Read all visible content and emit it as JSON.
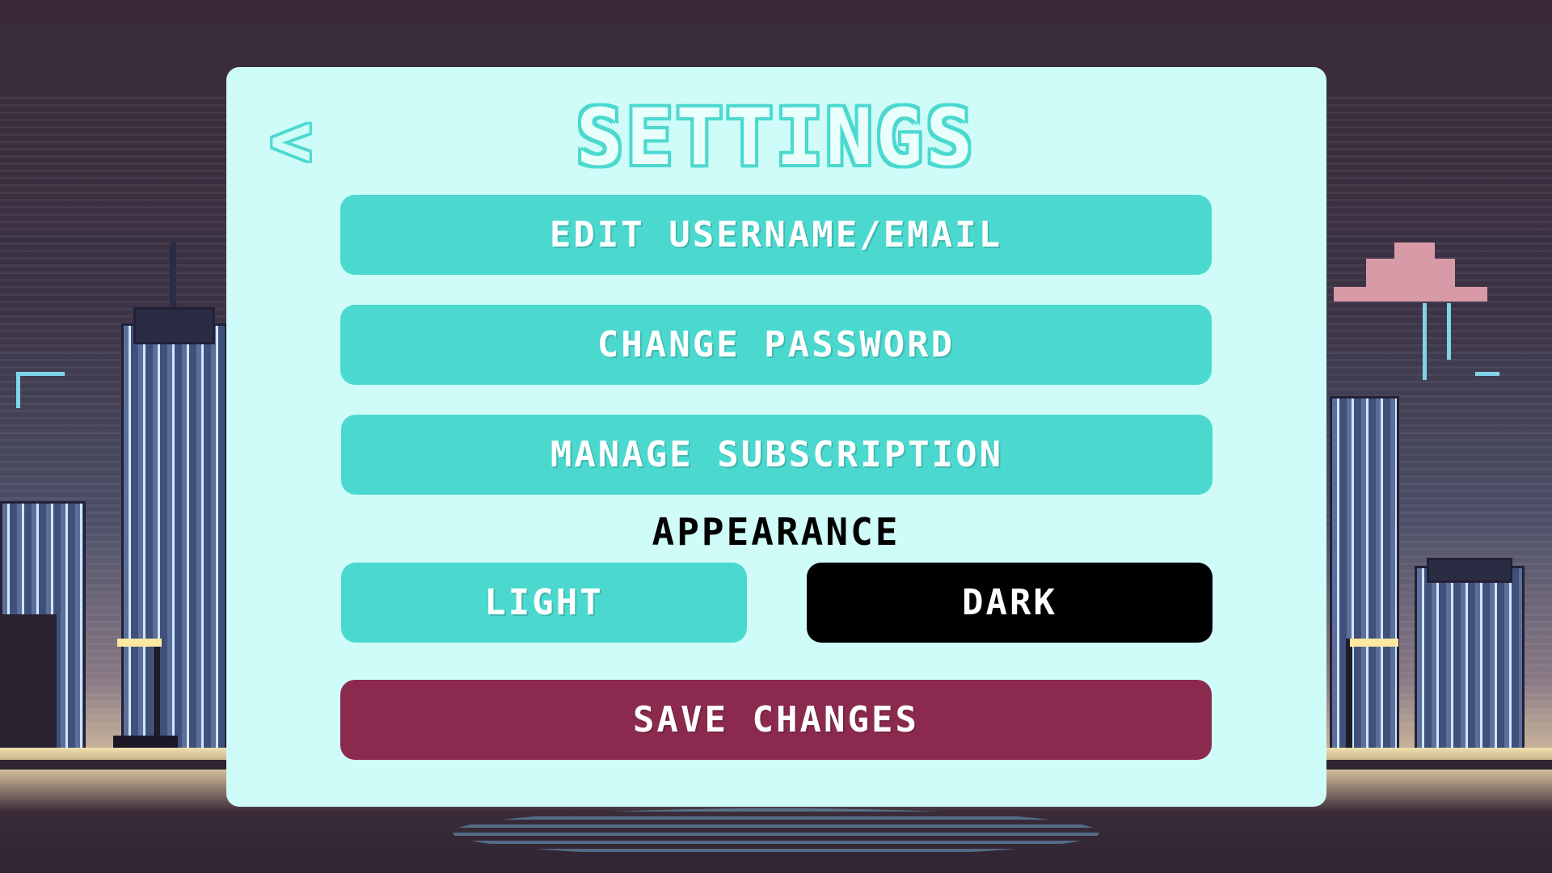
{
  "header": {
    "back_icon": "chevron-left-icon",
    "back_glyph": "<",
    "title": "SETTINGS"
  },
  "account": {
    "edit_username_email": "EDIT USERNAME/EMAIL",
    "change_password": "CHANGE PASSWORD",
    "manage_subscription": "MANAGE SUBSCRIPTION"
  },
  "appearance": {
    "label": "APPEARANCE",
    "light": "LIGHT",
    "dark": "DARK",
    "selected": "dark"
  },
  "actions": {
    "save": "SAVE CHANGES"
  },
  "colors": {
    "panel": "#cffcf8",
    "accent": "#4bd9cf",
    "dark_button": "#000000",
    "save_button": "#8b2a4e"
  }
}
